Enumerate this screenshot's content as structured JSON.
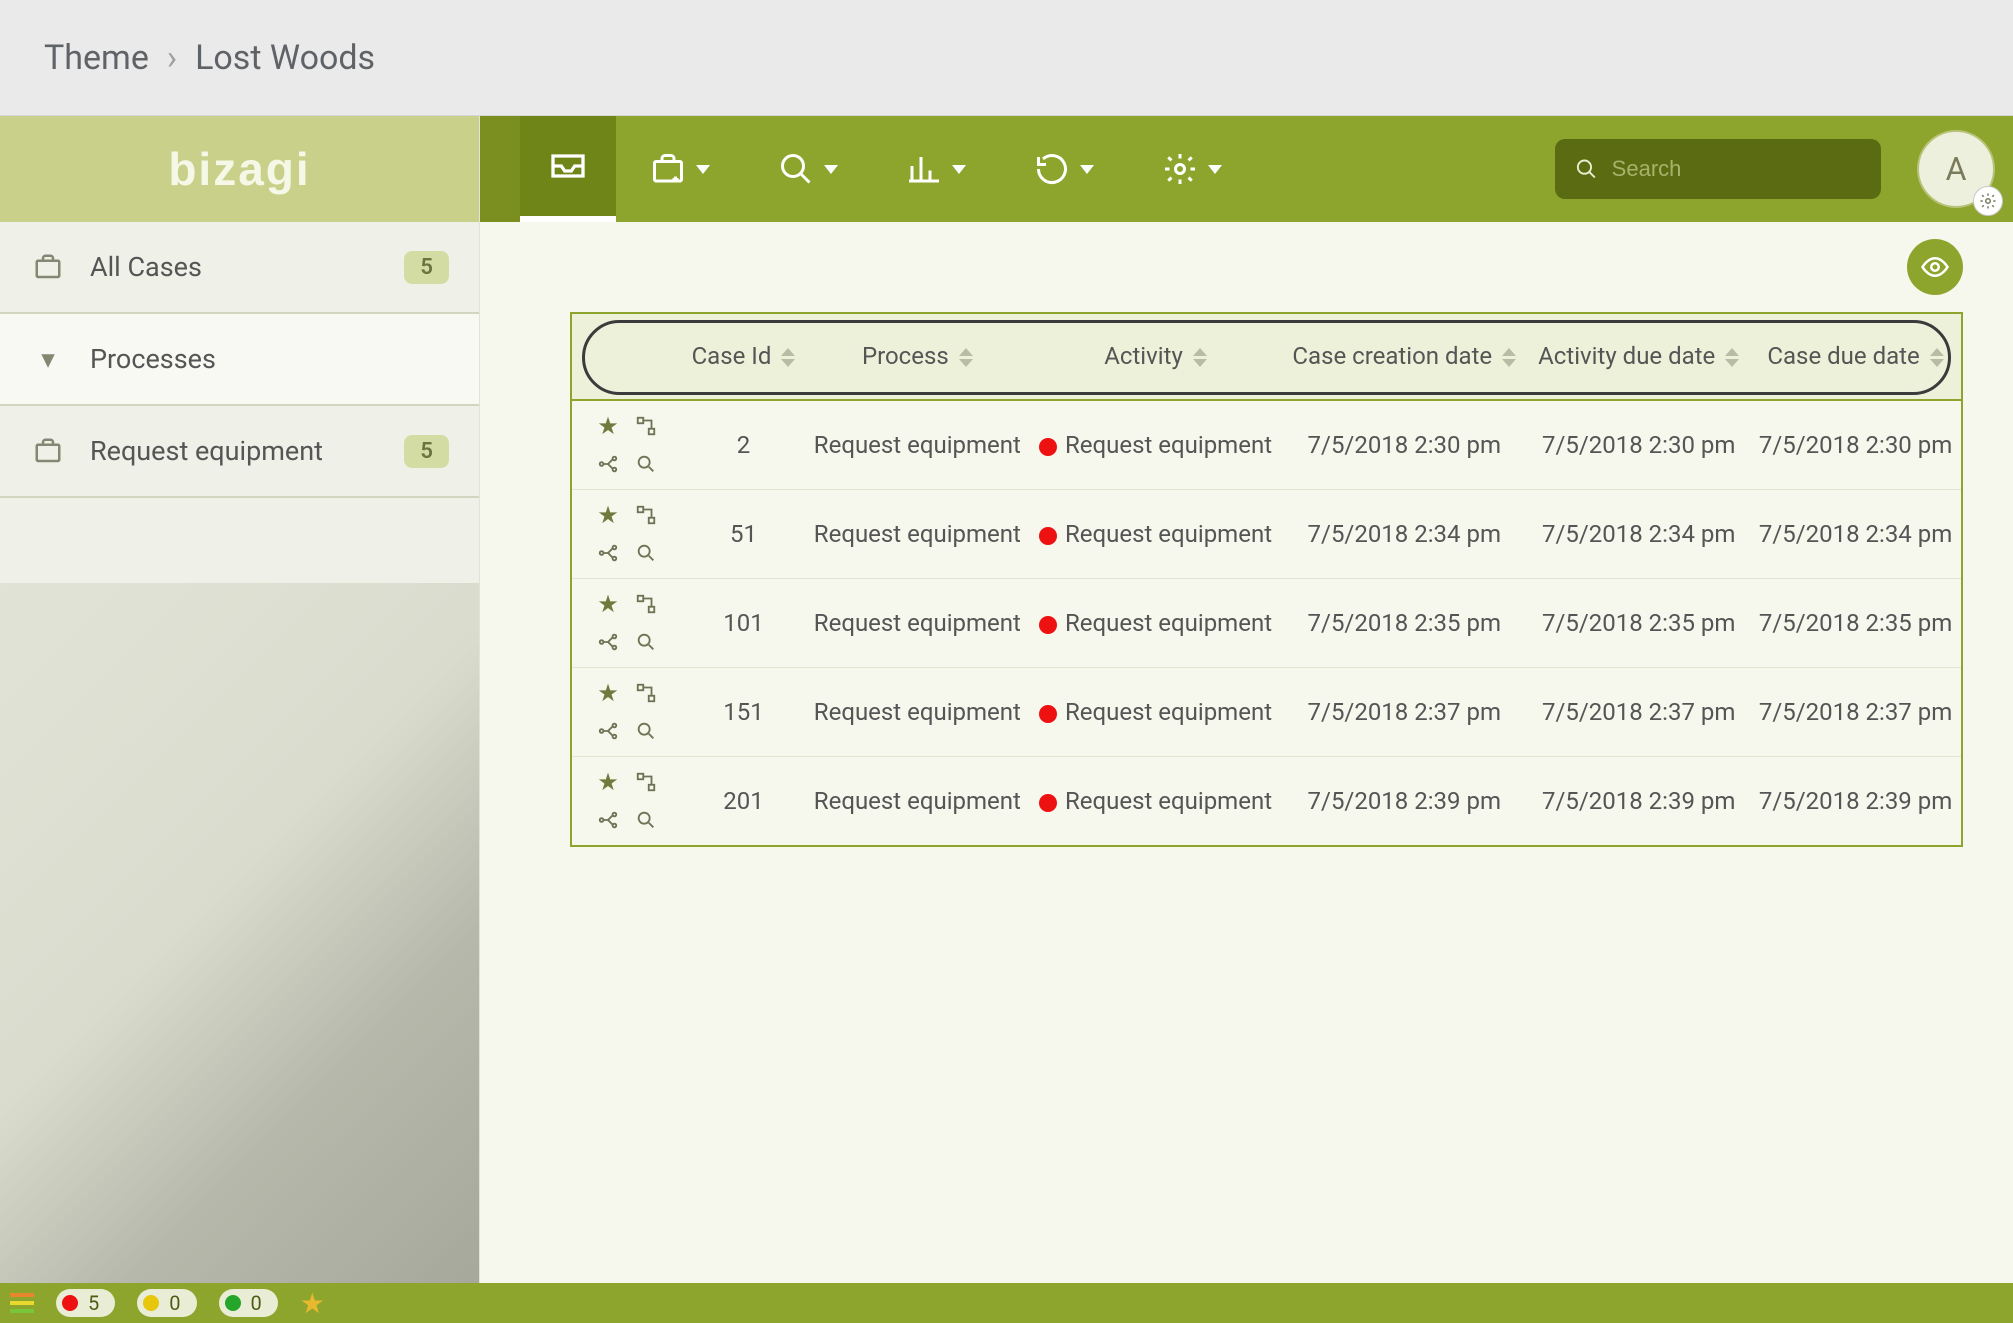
{
  "breadcrumb": {
    "root": "Theme",
    "current": "Lost Woods"
  },
  "logo_text": "bizagi",
  "sidebar": {
    "items": [
      {
        "label": "All Cases",
        "icon": "briefcase",
        "badge": "5",
        "type": "item"
      },
      {
        "label": "Processes",
        "icon": "caret",
        "badge": "",
        "type": "group"
      },
      {
        "label": "Request equipment",
        "icon": "briefcase",
        "badge": "5",
        "type": "item"
      }
    ]
  },
  "toolbar": {
    "search_placeholder": "Search",
    "avatar_initial": "A"
  },
  "table": {
    "columns": [
      "",
      "Case Id",
      "Process",
      "Activity",
      "Case creation date",
      "Activity due date",
      "Case due date"
    ],
    "rows": [
      {
        "case_id": "2",
        "process": "Request equipment",
        "activity": "Request equipment",
        "status": "red",
        "creation": "7/5/2018 2:30 pm",
        "act_due": "7/5/2018 2:30 pm",
        "case_due": "7/5/2018 2:30 pm"
      },
      {
        "case_id": "51",
        "process": "Request equipment",
        "activity": "Request equipment",
        "status": "red",
        "creation": "7/5/2018 2:34 pm",
        "act_due": "7/5/2018 2:34 pm",
        "case_due": "7/5/2018 2:34 pm"
      },
      {
        "case_id": "101",
        "process": "Request equipment",
        "activity": "Request equipment",
        "status": "red",
        "creation": "7/5/2018 2:35 pm",
        "act_due": "7/5/2018 2:35 pm",
        "case_due": "7/5/2018 2:35 pm"
      },
      {
        "case_id": "151",
        "process": "Request equipment",
        "activity": "Request equipment",
        "status": "red",
        "creation": "7/5/2018 2:37 pm",
        "act_due": "7/5/2018 2:37 pm",
        "case_due": "7/5/2018 2:37 pm"
      },
      {
        "case_id": "201",
        "process": "Request equipment",
        "activity": "Request equipment",
        "status": "red",
        "creation": "7/5/2018 2:39 pm",
        "act_due": "7/5/2018 2:39 pm",
        "case_due": "7/5/2018 2:39 pm"
      }
    ]
  },
  "footer": {
    "red_count": "5",
    "yellow_count": "0",
    "green_count": "0"
  }
}
